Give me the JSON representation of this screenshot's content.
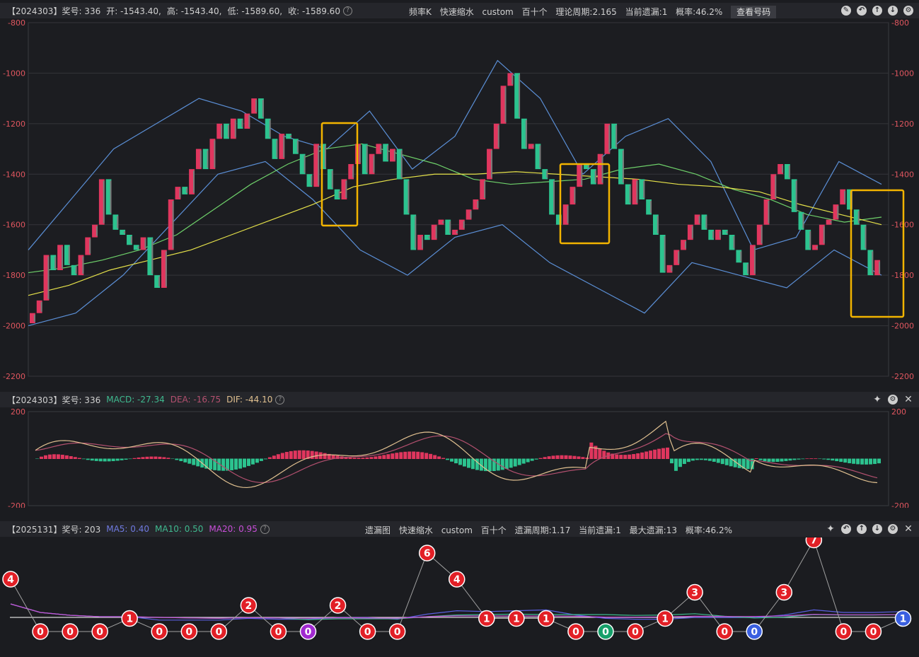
{
  "kline_header": {
    "issue": "【2024303】",
    "prize_label": "奖号: 336",
    "open": "开: -1543.40,",
    "high": "高: -1543.40,",
    "low": "低: -1589.60,",
    "close": "收: -1589.60",
    "mode": "频率K",
    "speed": "快速缩水",
    "custom": "custom",
    "group": "百十个",
    "cycle": "理论周期:2.165",
    "current": "当前遗漏:1",
    "prob": "概率:46.2%",
    "view_button": "查看号码"
  },
  "macd_header": {
    "issue": "【2024303】",
    "prize_label": "奖号: 336",
    "macd": "MACD: -27.34",
    "dea": "DEA: -16.75",
    "dif": "DIF: -44.10"
  },
  "miss_header": {
    "issue": "【2025131】",
    "prize_label": "奖号: 203",
    "ma5": "MA5: 0.40",
    "ma10": "MA10: 0.50",
    "ma20": "MA20: 0.95",
    "mode": "遗漏图",
    "speed": "快速缩水",
    "custom": "custom",
    "group": "百十个",
    "cycle": "遗漏周期:1.17",
    "current": "当前遗漏:1",
    "max": "最大遗漏:13",
    "prob": "概率:46.2%"
  },
  "chart_data": [
    {
      "type": "candlestick",
      "ylim": [
        -2200,
        -800
      ],
      "yticks": [
        "-800",
        "-1000",
        "-1200",
        "-1400",
        "-1600",
        "-1800",
        "-2000",
        "-2200"
      ],
      "close_points": [
        -1950,
        -1900,
        -1720,
        -1780,
        -1680,
        -1760,
        -1800,
        -1720,
        -1650,
        -1600,
        -1420,
        -1560,
        -1620,
        -1640,
        -1680,
        -1700,
        -1650,
        -1800,
        -1850,
        -1700,
        -1500,
        -1450,
        -1480,
        -1380,
        -1300,
        -1380,
        -1260,
        -1200,
        -1260,
        -1180,
        -1220,
        -1160,
        -1100,
        -1180,
        -1260,
        -1340,
        -1240,
        -1260,
        -1320,
        -1400,
        -1450,
        -1280,
        -1380,
        -1460,
        -1500,
        -1420,
        -1360,
        -1280,
        -1400,
        -1320,
        -1280,
        -1350,
        -1300,
        -1420,
        -1560,
        -1700,
        -1640,
        -1660,
        -1600,
        -1580,
        -1640,
        -1620,
        -1580,
        -1540,
        -1500,
        -1420,
        -1300,
        -1200,
        -1050,
        -1000,
        -1180,
        -1300,
        -1280,
        -1380,
        -1420,
        -1560,
        -1600,
        -1520,
        -1450,
        -1360,
        -1380,
        -1440,
        -1320,
        -1200,
        -1300,
        -1440,
        -1520,
        -1420,
        -1500,
        -1560,
        -1640,
        -1790,
        -1760,
        -1700,
        -1660,
        -1600,
        -1560,
        -1620,
        -1660,
        -1620,
        -1640,
        -1700,
        -1750,
        -1800,
        -1680,
        -1600,
        -1500,
        -1400,
        -1360,
        -1420,
        -1550,
        -1620,
        -1700,
        -1680,
        -1600,
        -1580,
        -1520,
        -1460,
        -1540,
        -1600,
        -1700,
        -1800,
        -1740
      ],
      "ma_yellow_points": [
        -1880,
        -1840,
        -1780,
        -1740,
        -1700,
        -1640,
        -1580,
        -1520,
        -1450,
        -1420,
        -1400,
        -1400,
        -1390,
        -1400,
        -1410,
        -1420,
        -1440,
        -1450,
        -1470,
        -1520,
        -1560,
        -1600
      ],
      "ma_green_points": [
        -1790,
        -1770,
        -1740,
        -1700,
        -1640,
        -1540,
        -1440,
        -1360,
        -1300,
        -1280,
        -1320,
        -1360,
        -1420,
        -1440,
        -1430,
        -1420,
        -1380,
        -1360,
        -1400,
        -1460,
        -1500,
        -1560,
        -1590,
        -1570
      ],
      "bollinger_upper_points": [
        -1700,
        -1500,
        -1300,
        -1200,
        -1100,
        -1150,
        -1250,
        -1300,
        -1150,
        -1380,
        -1250,
        -950,
        -1100,
        -1400,
        -1250,
        -1180,
        -1350,
        -1700,
        -1650,
        -1350,
        -1440
      ],
      "bollinger_lower_points": [
        -2000,
        -1950,
        -1800,
        -1600,
        -1400,
        -1350,
        -1500,
        -1700,
        -1800,
        -1650,
        -1600,
        -1750,
        -1850,
        -1950,
        -1750,
        -1800,
        -1850,
        -1700,
        -1800
      ],
      "highlight_boxes": 4
    },
    {
      "type": "bar",
      "series": [
        "MACD",
        "DEA",
        "DIF"
      ],
      "ylim": [
        -200,
        200
      ],
      "yticks": [
        "200",
        "-200"
      ]
    },
    {
      "type": "line",
      "series": [
        "MA5",
        "MA10",
        "MA20"
      ],
      "values": [
        4,
        0,
        0,
        0,
        1,
        0,
        0,
        0,
        2,
        0,
        0,
        2,
        0,
        0,
        6,
        4,
        1,
        1,
        1,
        0,
        0,
        0,
        1,
        3,
        0,
        0,
        3,
        7,
        0,
        0,
        1
      ],
      "label_colors": [
        "red",
        "red",
        "red",
        "red",
        "red",
        "red",
        "red",
        "red",
        "red",
        "red",
        "purple",
        "red",
        "red",
        "red",
        "red",
        "red",
        "red",
        "red",
        "red",
        "red",
        "green",
        "red",
        "red",
        "red",
        "red",
        "blue",
        "red",
        "red",
        "red",
        "red",
        "blue"
      ]
    }
  ]
}
